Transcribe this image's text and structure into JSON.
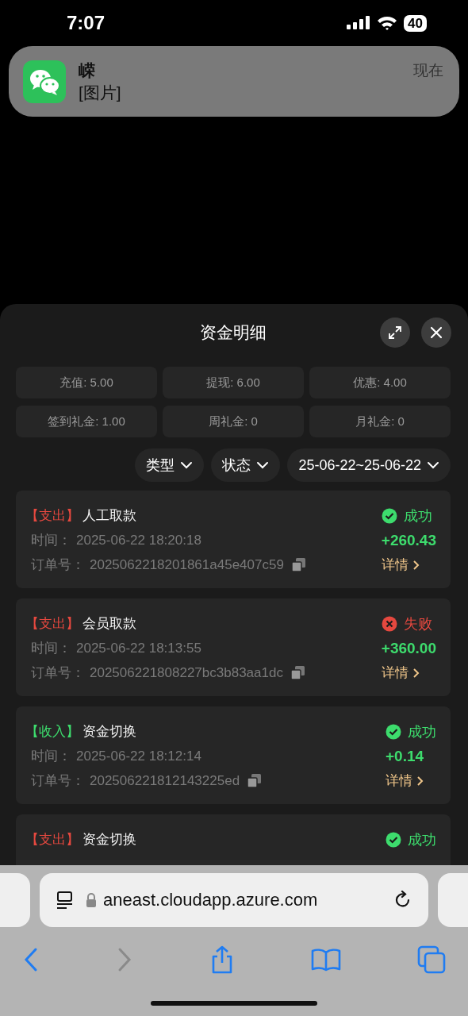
{
  "status_bar": {
    "time": "7:07",
    "battery": "40"
  },
  "notification": {
    "title": "嵘",
    "message": "[图片]",
    "time": "现在"
  },
  "sheet": {
    "title": "资金明细",
    "stats": [
      "充值: 5.00",
      "提现: 6.00",
      "优惠: 4.00",
      "签到礼金: 1.00",
      "周礼金: 0",
      "月礼金: 0"
    ],
    "filters": [
      "类型",
      "状态",
      "25-06-22~25-06-22"
    ]
  },
  "records": [
    {
      "type_label": "【支出】",
      "income": false,
      "title": "人工取款",
      "time_label": "时间：",
      "time": "2025-06-22 18:20:18",
      "order_label": "订单号：",
      "order_no": "2025062218201861a45e407c59",
      "success": true,
      "status_text": "成功",
      "amount": "+260.43",
      "details": "详情"
    },
    {
      "type_label": "【支出】",
      "income": false,
      "title": "会员取款",
      "time_label": "时间：",
      "time": "2025-06-22 18:13:55",
      "order_label": "订单号：",
      "order_no": "202506221808227bc3b83aa1dc",
      "success": false,
      "status_text": "失败",
      "amount": "+360.00",
      "details": "详情"
    },
    {
      "type_label": "【收入】",
      "income": true,
      "title": "资金切换",
      "time_label": "时间：",
      "time": "2025-06-22 18:12:14",
      "order_label": "订单号：",
      "order_no": "202506221812143225ed",
      "success": true,
      "status_text": "成功",
      "amount": "+0.14",
      "details": "详情"
    },
    {
      "type_label": "【支出】",
      "income": false,
      "title": "资金切换",
      "success": true,
      "status_text": "成功"
    }
  ],
  "browser": {
    "url": "aneast.cloudapp.azure.com",
    "back_disabled": false,
    "forward_disabled": true
  }
}
